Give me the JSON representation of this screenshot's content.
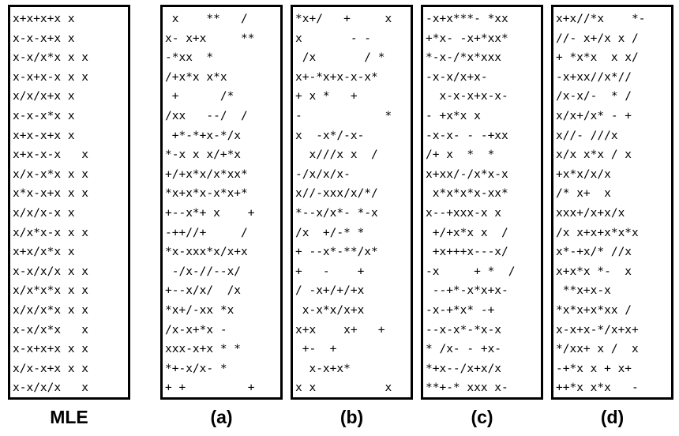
{
  "panels": [
    {
      "id": "mle",
      "caption": "MLE",
      "rows": [
        "x+x+x+x x",
        "x-x-x+x x",
        "x-x/x*x x x",
        "x-x+x-x x x",
        "x/x/x+x x",
        "x-x-x*x x",
        "x+x-x+x x",
        "x+x-x-x   x",
        "x/x-x*x x x",
        "x*x-x+x x x",
        "x/x/x-x x",
        "x/x*x-x x x",
        "x+x/x*x x",
        "x-x/x/x x x",
        "x/x*x*x x x",
        "x/x/x*x x x",
        "x-x/x*x   x",
        "x-x+x+x x x",
        "x/x-x+x x x",
        "x-x/x/x   x"
      ]
    },
    {
      "id": "a",
      "caption": "(a)",
      "rows": [
        " x    **   /",
        "x- x+x     **",
        "-*xx  *",
        "/+x*x x*x",
        " +      /*",
        "/xx   --/  /",
        " +*-*+x-*/x",
        "*-x x x/+*x",
        "+/+x*x/x*xx*",
        "*x+x*x-x*x+*",
        "+--x*+ x    +",
        "-++//+     /",
        "*x-xxx*x/x+x",
        " -/x-//--x/",
        "+--x/x/  /x",
        "*x+/-xx *x",
        "/x-x+*x -",
        "xxx-x+x * *",
        "*+-x/x- *",
        "+ +         +"
      ]
    },
    {
      "id": "b",
      "caption": "(b)",
      "rows": [
        "*x+/   +     x",
        "x       - -",
        " /x       / *",
        "x+-*x+x-x-x*",
        "+ x *   +",
        "-            *",
        "x  -x*/-x-",
        "  x///x x  /",
        "-/x/x/x-",
        "x//-xxx/x/*/",
        "*--x/x*- *-x",
        "/x  +/-* *",
        "+ --x*-**/x*",
        "+   -    +",
        "/ -x+/+/+x",
        " x-x*x/x+x",
        "x+x    x+   +",
        " +-  +",
        "  x-x+x*",
        "x x          x"
      ]
    },
    {
      "id": "c",
      "caption": "(c)",
      "rows": [
        "-x+x***- *xx",
        "+*x- -x+*xx*",
        "*-x-/*x*xxx",
        "-x-x/x+x-",
        "  x-x-x+x-x-",
        "- +x*x x",
        "-x-x- - -+xx",
        "/+ x  *  *",
        "x+xx/-/x*x-x",
        " x*x*x*x-xx*",
        "x--+xxx-x x",
        " +/+x*x x  /",
        " +x+++x---x/",
        "-x     + *  /",
        " --+*-x*x+x-",
        "-x-+*x* -+",
        "--x-x*-*x-x",
        "* /x- - +x-",
        "*+x--/x+x/x",
        "**+-* xxx x-"
      ]
    },
    {
      "id": "d",
      "caption": "(d)",
      "rows": [
        "x+x//*x    *-",
        "//- x+/x x /",
        "+ *x*x  x x/",
        "-x+xx//x*//",
        "/x-x/-  * /",
        "x/x+/x* - +",
        "x//- ///x",
        "x/x x*x / x",
        "+x*x/x/x",
        "/* x+  x",
        "xxx+/x+x/x",
        "/x x+x+x*x*x",
        "x*-+x/* //x",
        "x+x*x *-  x",
        " **x+x-x",
        "*x*x+x*xx /",
        "x-x+x-*/x+x+",
        "*/xx+ x /  x",
        "-+*x x + x+",
        "++*x x*x   -"
      ]
    }
  ]
}
